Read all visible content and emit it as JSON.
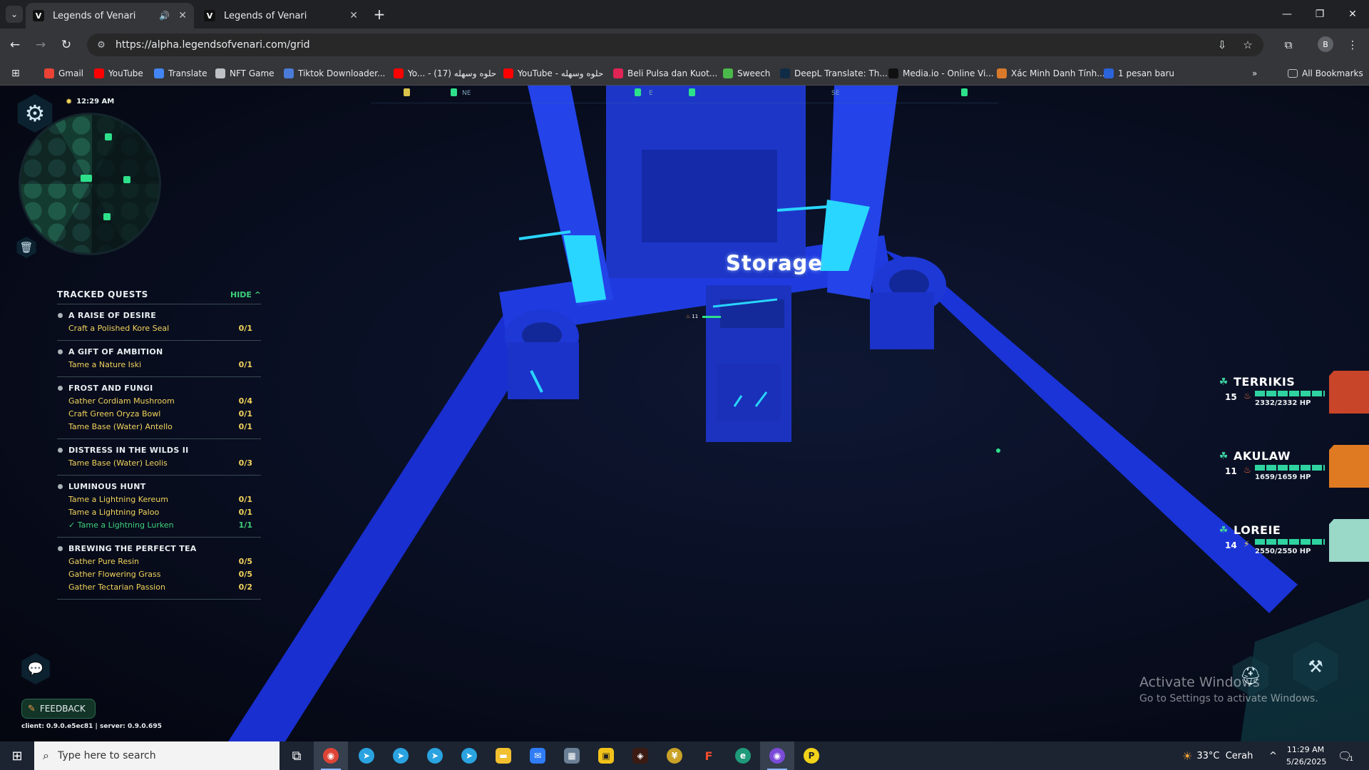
{
  "browser": {
    "tabs": [
      {
        "title": "Legends of Venari",
        "active": true,
        "audio": true
      },
      {
        "title": "Legends of Venari",
        "active": false,
        "audio": false
      }
    ],
    "url": "https://alpha.legendsofvenari.com/grid",
    "profile_initial": "B",
    "bookmarks": [
      {
        "label": "Gmail",
        "icon": "gmail-icon",
        "color": "#ea4335"
      },
      {
        "label": "YouTube",
        "icon": "youtube-icon",
        "color": "#ff0000"
      },
      {
        "label": "Translate",
        "icon": "translate-icon",
        "color": "#4285f4"
      },
      {
        "label": "NFT Game",
        "icon": "folder-icon",
        "color": "#bdc1c6"
      },
      {
        "label": "Tiktok Downloader...",
        "icon": "download-icon",
        "color": "#4a7bd8"
      },
      {
        "label": "Yo... - حلوه وسهله (17)",
        "icon": "youtube-icon",
        "color": "#ff0000"
      },
      {
        "label": "YouTube - حلوه وسهله",
        "icon": "youtube-icon",
        "color": "#ff0000"
      },
      {
        "label": "Beli Pulsa dan Kuot...",
        "icon": "pulsa-icon",
        "color": "#e02454"
      },
      {
        "label": "Sweech",
        "icon": "sweech-icon",
        "color": "#4bb84b"
      },
      {
        "label": "DeepL Translate: Th...",
        "icon": "deepl-icon",
        "color": "#0f2b46"
      },
      {
        "label": "Media.io - Online Vi...",
        "icon": "mediaio-icon",
        "color": "#111111"
      },
      {
        "label": "Xác Minh Danh Tính...",
        "icon": "verify-icon",
        "color": "#d97a2b"
      },
      {
        "label": "1 pesan baru",
        "icon": "message-icon",
        "color": "#2b63d9"
      }
    ],
    "all_bookmarks": "All Bookmarks"
  },
  "game": {
    "compass": [
      "NE",
      "E",
      "SE"
    ],
    "clock": "12:29 AM",
    "storage_label": "Storage",
    "nameplate_level": "11",
    "quests": {
      "header": "TRACKED QUESTS",
      "hide_label": "HIDE",
      "list": [
        {
          "name": "A RAISE OF DESIRE",
          "tasks": [
            {
              "label": "Craft a Polished Kore Seal",
              "progress": "0/1",
              "done": false
            }
          ]
        },
        {
          "name": "A GIFT OF AMBITION",
          "tasks": [
            {
              "label": "Tame a Nature Iski",
              "progress": "0/1",
              "done": false
            }
          ]
        },
        {
          "name": "FROST AND FUNGI",
          "tasks": [
            {
              "label": "Gather Cordiam Mushroom",
              "progress": "0/4",
              "done": false
            },
            {
              "label": "Craft Green Oryza Bowl",
              "progress": "0/1",
              "done": false
            },
            {
              "label": "Tame Base (Water) Antello",
              "progress": "0/1",
              "done": false
            }
          ]
        },
        {
          "name": "DISTRESS IN THE WILDS II",
          "tasks": [
            {
              "label": "Tame Base (Water) Leolis",
              "progress": "0/3",
              "done": false
            }
          ]
        },
        {
          "name": "LUMINOUS HUNT",
          "tasks": [
            {
              "label": "Tame a Lightning Kereum",
              "progress": "0/1",
              "done": false
            },
            {
              "label": "Tame a Lightning Paloo",
              "progress": "0/1",
              "done": false
            },
            {
              "label": "✓ Tame a Lightning Lurken",
              "progress": "1/1",
              "done": true
            }
          ]
        },
        {
          "name": "BREWING THE PERFECT TEA",
          "tasks": [
            {
              "label": "Gather Pure Resin",
              "progress": "0/5",
              "done": false
            },
            {
              "label": "Gather Flowering Grass",
              "progress": "0/5",
              "done": false
            },
            {
              "label": "Gather Tectarian Passion",
              "progress": "0/2",
              "done": false
            }
          ]
        }
      ]
    },
    "party": [
      {
        "name": "TERRIKIS",
        "level": "15",
        "element_icon": "fire-icon",
        "hp_text": "2332/2332 HP",
        "hp": 1.0,
        "portrait_color": "#c9452a"
      },
      {
        "name": "AKULAW",
        "level": "11",
        "element_icon": "fire-icon",
        "hp_text": "1659/1659 HP",
        "hp": 1.0,
        "portrait_color": "#e07a22"
      },
      {
        "name": "LOREIE",
        "level": "14",
        "element_icon": "lightning-icon",
        "hp_text": "2550/2550 HP",
        "hp": 1.0,
        "portrait_color": "#9ad8c8"
      }
    ],
    "feedback_label": "FEEDBACK",
    "version": "client: 0.9.0.e5ec81 | server: 0.9.0.695"
  },
  "watermark": {
    "line1": "Activate Windows",
    "line2": "Go to Settings to activate Windows."
  },
  "taskbar": {
    "search_placeholder": "Type here to search",
    "weather": "33°C  Cerah",
    "time": "11:29 AM",
    "date": "5/26/2025",
    "notification_count": "1"
  }
}
